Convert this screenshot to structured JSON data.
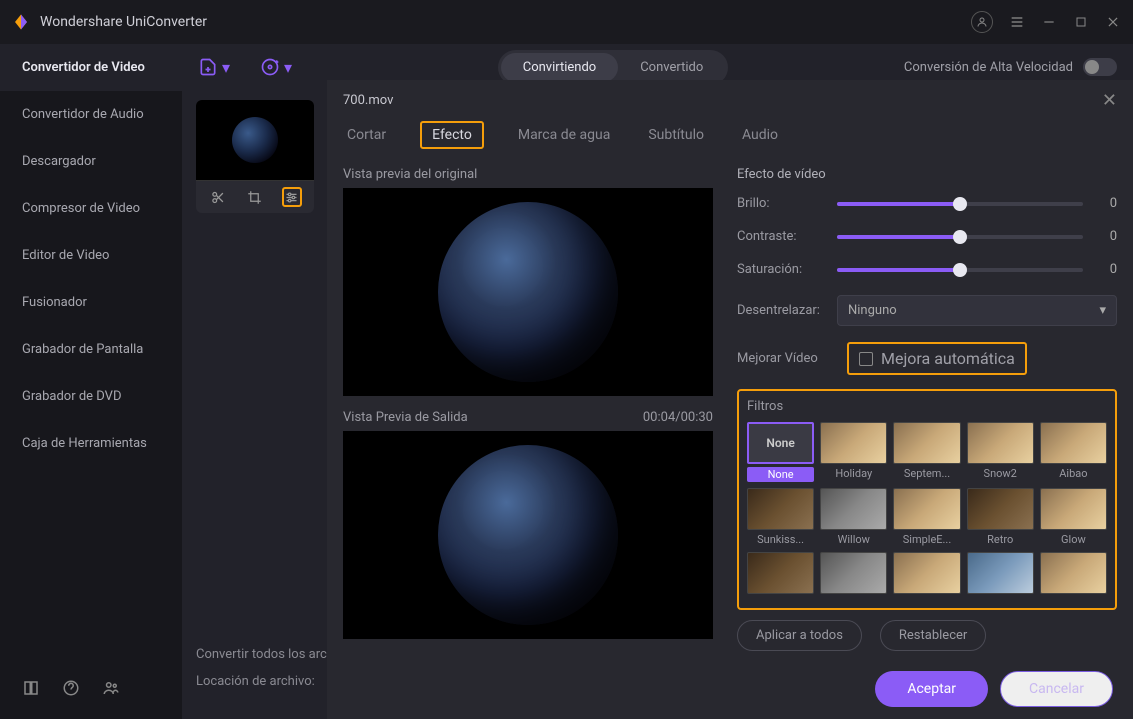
{
  "app_title": "Wondershare UniConverter",
  "sidebar": {
    "items": [
      {
        "label": "Convertidor de Video"
      },
      {
        "label": "Convertidor de Audio"
      },
      {
        "label": "Descargador"
      },
      {
        "label": "Compresor de Video"
      },
      {
        "label": "Editor de Video"
      },
      {
        "label": "Fusionador"
      },
      {
        "label": "Grabador de Pantalla"
      },
      {
        "label": "Grabador de DVD"
      },
      {
        "label": "Caja de Herramientas"
      }
    ]
  },
  "toolbar": {
    "tab_converting": "Convirtiendo",
    "tab_converted": "Convertido",
    "hispeed_label": "Conversión de Alta Velocidad"
  },
  "bottom": {
    "convert_all": "Convertir todos los archivos",
    "location": "Locación de archivo:"
  },
  "modal": {
    "filename": "700.mov",
    "tabs": {
      "cut": "Cortar",
      "effect": "Efecto",
      "watermark": "Marca de agua",
      "subtitle": "Subtítulo",
      "audio": "Audio"
    },
    "preview_original": "Vista previa del original",
    "preview_output": "Vista Previa de Salida",
    "timecode": "00:04/00:30",
    "effect_section": "Efecto de vídeo",
    "sliders": {
      "brightness": {
        "label": "Brillo:",
        "value": "0"
      },
      "contrast": {
        "label": "Contraste:",
        "value": "0"
      },
      "saturation": {
        "label": "Saturación:",
        "value": "0"
      }
    },
    "deinterlace": {
      "label": "Desentrelazar:",
      "selected": "Ninguno"
    },
    "enhance": {
      "label": "Mejorar Vídeo",
      "checkbox": "Mejora automática"
    },
    "filters_title": "Filtros",
    "filters": [
      {
        "name": "None"
      },
      {
        "name": "Holiday"
      },
      {
        "name": "Septem..."
      },
      {
        "name": "Snow2"
      },
      {
        "name": "Aibao"
      },
      {
        "name": "Sunkiss..."
      },
      {
        "name": "Willow"
      },
      {
        "name": "SimpleE..."
      },
      {
        "name": "Retro"
      },
      {
        "name": "Glow"
      }
    ],
    "none_thumb_text": "None",
    "apply_all": "Aplicar a todos",
    "reset": "Restablecer",
    "accept": "Aceptar",
    "cancel": "Cancelar"
  }
}
